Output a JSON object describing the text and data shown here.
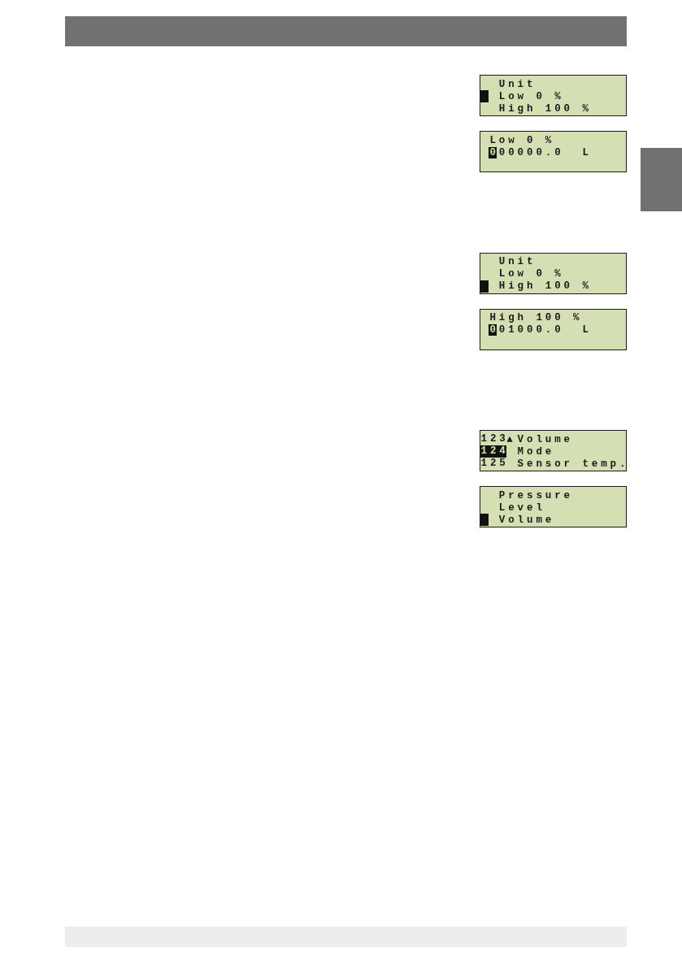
{
  "sections": [
    {
      "displays": [
        {
          "kind": "menu",
          "lines": [
            {
              "text": "Unit",
              "selected": false
            },
            {
              "text": "Low 0 %",
              "selected": true
            },
            {
              "text": "High 100 %",
              "selected": false
            }
          ]
        },
        {
          "kind": "edit",
          "title": "Low 0 %",
          "value": [
            {
              "text": "0",
              "selected": true
            },
            {
              "text": "00000.0",
              "selected": false
            }
          ],
          "unit": "L"
        }
      ]
    },
    {
      "displays": [
        {
          "kind": "menu",
          "lines": [
            {
              "text": "Unit",
              "selected": false
            },
            {
              "text": "Low 0 %",
              "selected": false
            },
            {
              "text": "High 100 %",
              "selected": true
            }
          ]
        },
        {
          "kind": "edit",
          "title": "High 100 %",
          "value": [
            {
              "text": "0",
              "selected": true
            },
            {
              "text": "01000.0",
              "selected": false
            }
          ],
          "unit": "L"
        }
      ]
    },
    {
      "displays": [
        {
          "kind": "numbered_menu",
          "lines": [
            {
              "number": "123",
              "marker": "▲",
              "text": "Volume",
              "selected": false
            },
            {
              "number": "124",
              "text": "Mode",
              "selected": true
            },
            {
              "number": "125",
              "text": "Sensor temp.",
              "selected": false
            }
          ]
        },
        {
          "kind": "menu",
          "lines": [
            {
              "text": "Pressure",
              "selected": false
            },
            {
              "text": "Level",
              "selected": false
            },
            {
              "text": "Volume",
              "selected": true
            }
          ]
        }
      ]
    }
  ]
}
